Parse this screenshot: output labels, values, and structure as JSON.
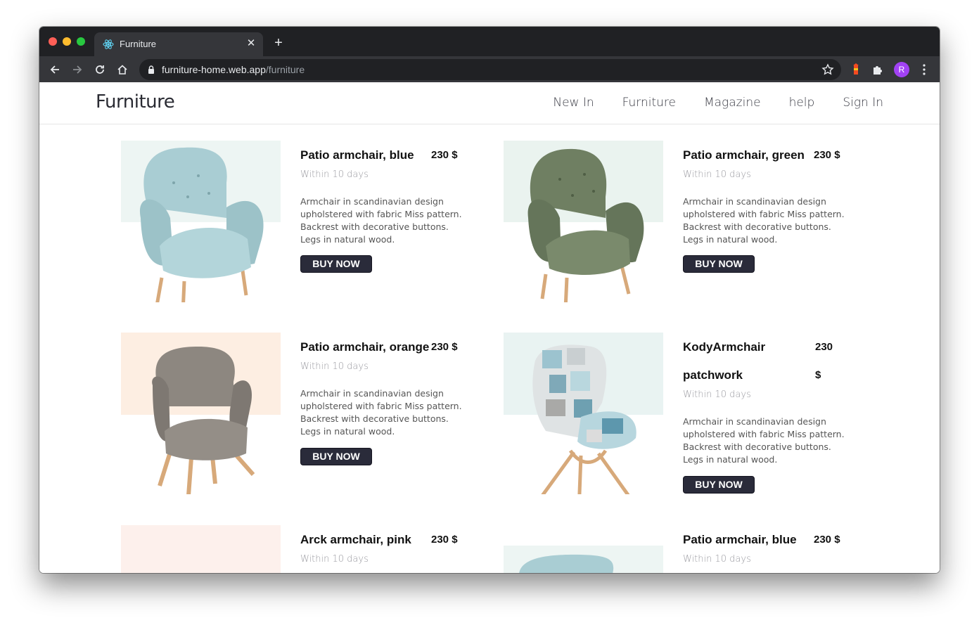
{
  "browser": {
    "tab_title": "Furniture",
    "url_host": "furniture-home.web.app",
    "url_path": "/furniture",
    "profile_initial": "R"
  },
  "site": {
    "brand": "Furniture",
    "nav": [
      "New In",
      "Furniture",
      "Magazine",
      "help",
      "Sign In"
    ]
  },
  "products": [
    {
      "name": "Patio armchair, blue",
      "price": "230 $",
      "shipping": "Within 10 days",
      "description": [
        "Armchair in scandinavian design",
        "upholstered with fabric Miss pattern.",
        "Backrest with decorative buttons.",
        "Legs in natural wood."
      ],
      "button": "BUY NOW",
      "bg_color": "#edf5f3",
      "chair_color": "#a9cdd3"
    },
    {
      "name": "Patio armchair, green",
      "price": "230 $",
      "shipping": "Within 10 days",
      "description": [
        "Armchair in scandinavian design",
        "upholstered with fabric Miss pattern.",
        "Backrest with decorative buttons.",
        "Legs in natural wood."
      ],
      "button": "BUY NOW",
      "bg_color": "#eaf3ef",
      "chair_color": "#6f7f62"
    },
    {
      "name": "Patio armchair, orange",
      "price": "230 $",
      "shipping": "Within 10 days",
      "description": [
        "Armchair in scandinavian design",
        "upholstered with fabric Miss pattern.",
        "Backrest with decorative buttons.",
        "Legs in natural wood."
      ],
      "button": "BUY NOW",
      "bg_color": "#fdeee2",
      "chair_color": "#8d8780"
    },
    {
      "name_line1": "KodyArmchair",
      "name_line2": "patchwork",
      "price_line1": "230",
      "price_line2": "$",
      "shipping": "Within 10 days",
      "description": [
        "Armchair in scandinavian design",
        "upholstered with fabric Miss pattern.",
        "Backrest with decorative buttons.",
        "Legs in natural wood."
      ],
      "button": "BUY NOW",
      "bg_color": "#e9f3f2",
      "chair_color": "#9cc3cf"
    },
    {
      "name": "Arck armchair, pink",
      "price": "230 $",
      "shipping": "Within 10 days",
      "bg_color": "#fdf0ec"
    },
    {
      "name": "Patio armchair, blue",
      "price": "230 $",
      "shipping": "Within 10 days",
      "bg_color": "#edf5f3",
      "chair_color": "#a9cdd3"
    }
  ]
}
